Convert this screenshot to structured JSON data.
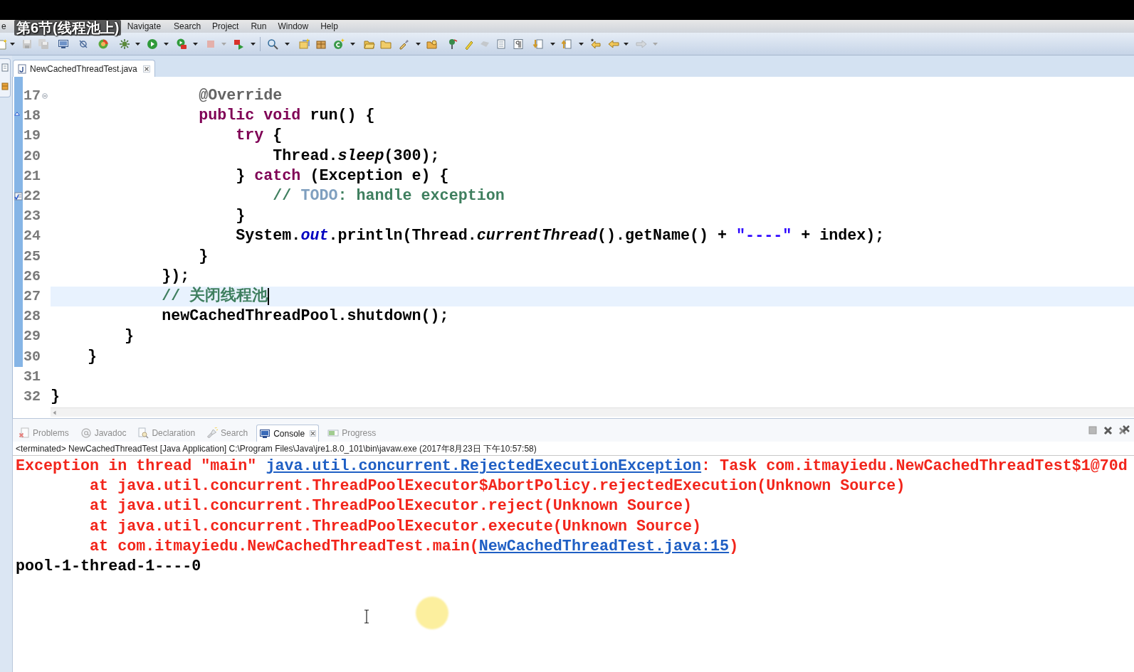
{
  "menu_bar": {
    "items": [
      "e",
      "Navigate",
      "Search",
      "Project",
      "Run",
      "Window",
      "Help"
    ]
  },
  "video_caption": "第6节(线程池上)",
  "editor": {
    "tabs": [
      {
        "label": "NewCachedThreadTest.java",
        "selected": true
      }
    ],
    "lines": [
      {
        "number": "17",
        "in_range": true,
        "current": false,
        "kind": "fold",
        "tokens": [
          {
            "text": "                @Override",
            "kind": "annotation"
          }
        ]
      },
      {
        "number": "18",
        "in_range": true,
        "current": false,
        "kind": "override",
        "tokens": [
          {
            "text": "                public void",
            "kind": "keyword"
          },
          {
            "text": " run() {",
            "kind": "plain"
          }
        ]
      },
      {
        "number": "19",
        "in_range": true,
        "current": false,
        "kind": "plain",
        "tokens": [
          {
            "text": "                    try",
            "kind": "keyword"
          },
          {
            "text": " {",
            "kind": "plain"
          }
        ]
      },
      {
        "number": "20",
        "in_range": true,
        "current": false,
        "kind": "plain",
        "tokens": [
          {
            "text": "                        Thread.",
            "kind": "plain"
          },
          {
            "text": "sleep",
            "kind": "static_method"
          },
          {
            "text": "(300);",
            "kind": "plain"
          }
        ]
      },
      {
        "number": "21",
        "in_range": true,
        "current": false,
        "kind": "plain",
        "tokens": [
          {
            "text": "                    } ",
            "kind": "plain"
          },
          {
            "text": "catch",
            "kind": "keyword"
          },
          {
            "text": " (Exception e) {",
            "kind": "plain"
          }
        ]
      },
      {
        "number": "22",
        "in_range": true,
        "current": false,
        "kind": "task",
        "tokens": [
          {
            "text": "                        // ",
            "kind": "comment"
          },
          {
            "text": "TODO",
            "kind": "todo"
          },
          {
            "text": ": handle exception",
            "kind": "comment"
          }
        ]
      },
      {
        "number": "23",
        "in_range": true,
        "current": false,
        "kind": "plain",
        "tokens": [
          {
            "text": "                    }",
            "kind": "plain"
          }
        ]
      },
      {
        "number": "24",
        "in_range": true,
        "current": false,
        "kind": "plain",
        "tokens": [
          {
            "text": "                    System.",
            "kind": "plain"
          },
          {
            "text": "out",
            "kind": "static_field"
          },
          {
            "text": ".println(Thread.",
            "kind": "plain"
          },
          {
            "text": "currentThread",
            "kind": "static_method"
          },
          {
            "text": "().getName() + ",
            "kind": "plain"
          },
          {
            "text": "\"----\"",
            "kind": "string"
          },
          {
            "text": " + index);",
            "kind": "plain"
          }
        ]
      },
      {
        "number": "25",
        "in_range": true,
        "current": false,
        "kind": "plain",
        "tokens": [
          {
            "text": "                }",
            "kind": "plain"
          }
        ]
      },
      {
        "number": "26",
        "in_range": true,
        "current": false,
        "kind": "plain",
        "tokens": [
          {
            "text": "            });",
            "kind": "plain"
          }
        ]
      },
      {
        "number": "27",
        "in_range": true,
        "current": true,
        "kind": "plain",
        "tokens": [
          {
            "text": "            // 关闭线程池",
            "kind": "comment"
          }
        ]
      },
      {
        "number": "28",
        "in_range": true,
        "current": false,
        "kind": "plain",
        "tokens": [
          {
            "text": "            newCachedThreadPool.shutdown();",
            "kind": "plain"
          }
        ]
      },
      {
        "number": "29",
        "in_range": true,
        "current": false,
        "kind": "plain",
        "tokens": [
          {
            "text": "        }",
            "kind": "plain"
          }
        ]
      },
      {
        "number": "30",
        "in_range": true,
        "current": false,
        "kind": "plain",
        "tokens": [
          {
            "text": "    }",
            "kind": "plain"
          }
        ]
      },
      {
        "number": "31",
        "in_range": false,
        "current": false,
        "kind": "plain"
      },
      {
        "number": "32",
        "in_range": false,
        "current": false,
        "kind": "plain",
        "tokens": [
          {
            "text": "}",
            "kind": "plain"
          }
        ]
      }
    ]
  },
  "console": {
    "tabs": [
      {
        "label": "Problems",
        "selected": false
      },
      {
        "label": "Javadoc",
        "selected": false
      },
      {
        "label": "Declaration",
        "selected": false
      },
      {
        "label": "Search",
        "selected": false
      },
      {
        "label": "Console",
        "selected": true
      },
      {
        "label": "Progress",
        "selected": false
      }
    ],
    "header": "<terminated> NewCachedThreadTest [Java Application] C:\\Program Files\\Java\\jre1.8.0_101\\bin\\javaw.exe (2017年8月23日 下午10:57:58)",
    "lines": [
      {
        "kind": "exception",
        "segments": [
          {
            "text": "Exception in thread \"main\" ",
            "kind": "text"
          },
          {
            "text": "java.util.concurrent.RejectedExecutionException",
            "kind": "link"
          },
          {
            "text": ": Task com.itmayiedu.NewCachedThreadTest$1@70d",
            "kind": "text"
          }
        ]
      },
      {
        "kind": "stack_frame",
        "segments": [
          {
            "text": "        at java.util.concurrent.ThreadPoolExecutor$AbortPolicy.rejectedExecution(Unknown Source)",
            "kind": "text"
          }
        ]
      },
      {
        "kind": "stack_frame",
        "segments": [
          {
            "text": "        at java.util.concurrent.ThreadPoolExecutor.reject(Unknown Source)",
            "kind": "text"
          }
        ]
      },
      {
        "kind": "stack_frame",
        "segments": [
          {
            "text": "        at java.util.concurrent.ThreadPoolExecutor.execute(Unknown Source)",
            "kind": "text"
          }
        ]
      },
      {
        "kind": "stack_frame",
        "segments": [
          {
            "text": "        at com.itmayiedu.NewCachedThreadTest.main(",
            "kind": "text"
          },
          {
            "text": "NewCachedThreadTest.java:15",
            "kind": "link"
          },
          {
            "text": ")",
            "kind": "text"
          }
        ]
      },
      {
        "kind": "output",
        "segments": [
          {
            "text": "pool-1-thread-1----0",
            "kind": "text"
          }
        ]
      }
    ]
  }
}
